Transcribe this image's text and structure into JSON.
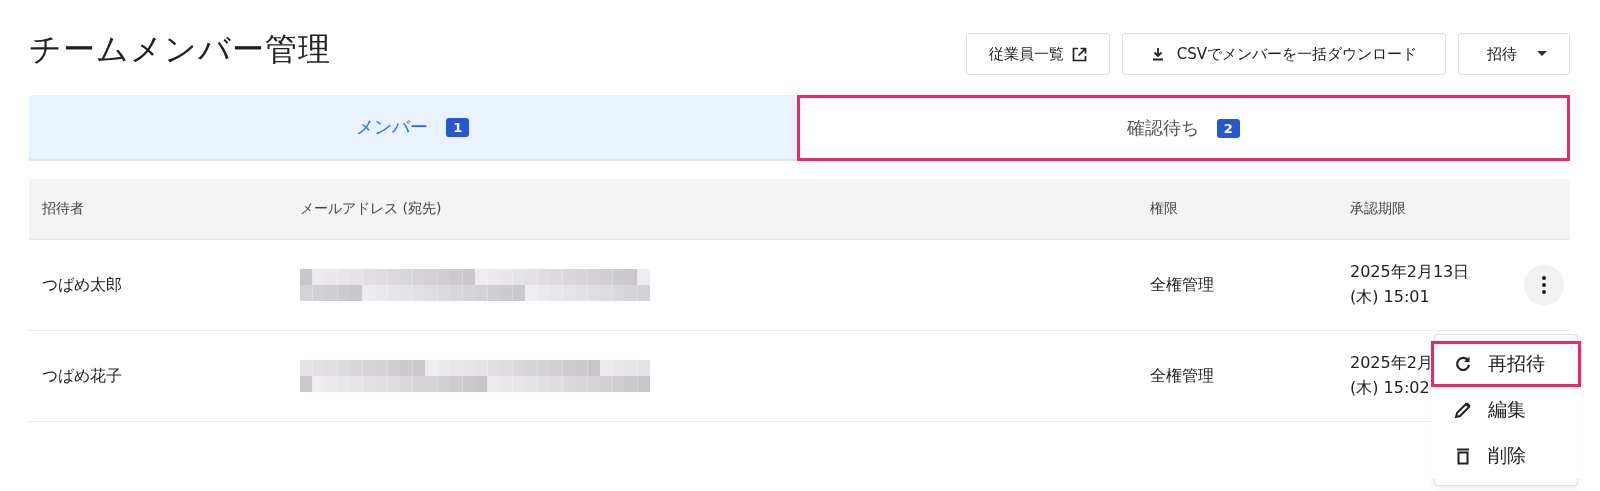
{
  "page": {
    "title": "チームメンバー管理"
  },
  "actions": [
    {
      "label": "従業員一覧",
      "kind": "external"
    },
    {
      "label": "CSVでメンバーを一括ダウンロード",
      "kind": "download"
    },
    {
      "label": "招待",
      "kind": "dropdown"
    }
  ],
  "tabs": [
    {
      "label": "メンバー",
      "count": "1",
      "selected": true,
      "highlighted": false
    },
    {
      "label": "確認待ち",
      "count": "2",
      "selected": false,
      "highlighted": true
    }
  ],
  "table": {
    "columns": [
      "招待者",
      "メールアドレス (宛先)",
      "権限",
      "承認期限"
    ],
    "rows": [
      {
        "inviter": "つばめ太郎",
        "permission": "全権管理",
        "deadline": [
          "2025年2月13日",
          "(木) 15:01"
        ],
        "menu_button": true
      },
      {
        "inviter": "つばめ花子",
        "permission": "全権管理",
        "deadline": [
          "2025年2月",
          "(木) 15:02"
        ],
        "menu_button": false
      }
    ]
  },
  "row_menu": {
    "items": [
      {
        "label": "再招待",
        "kind": "resend",
        "highlighted": true
      },
      {
        "label": "編集",
        "kind": "edit",
        "highlighted": false
      },
      {
        "label": "削除",
        "kind": "delete",
        "highlighted": false
      }
    ]
  }
}
